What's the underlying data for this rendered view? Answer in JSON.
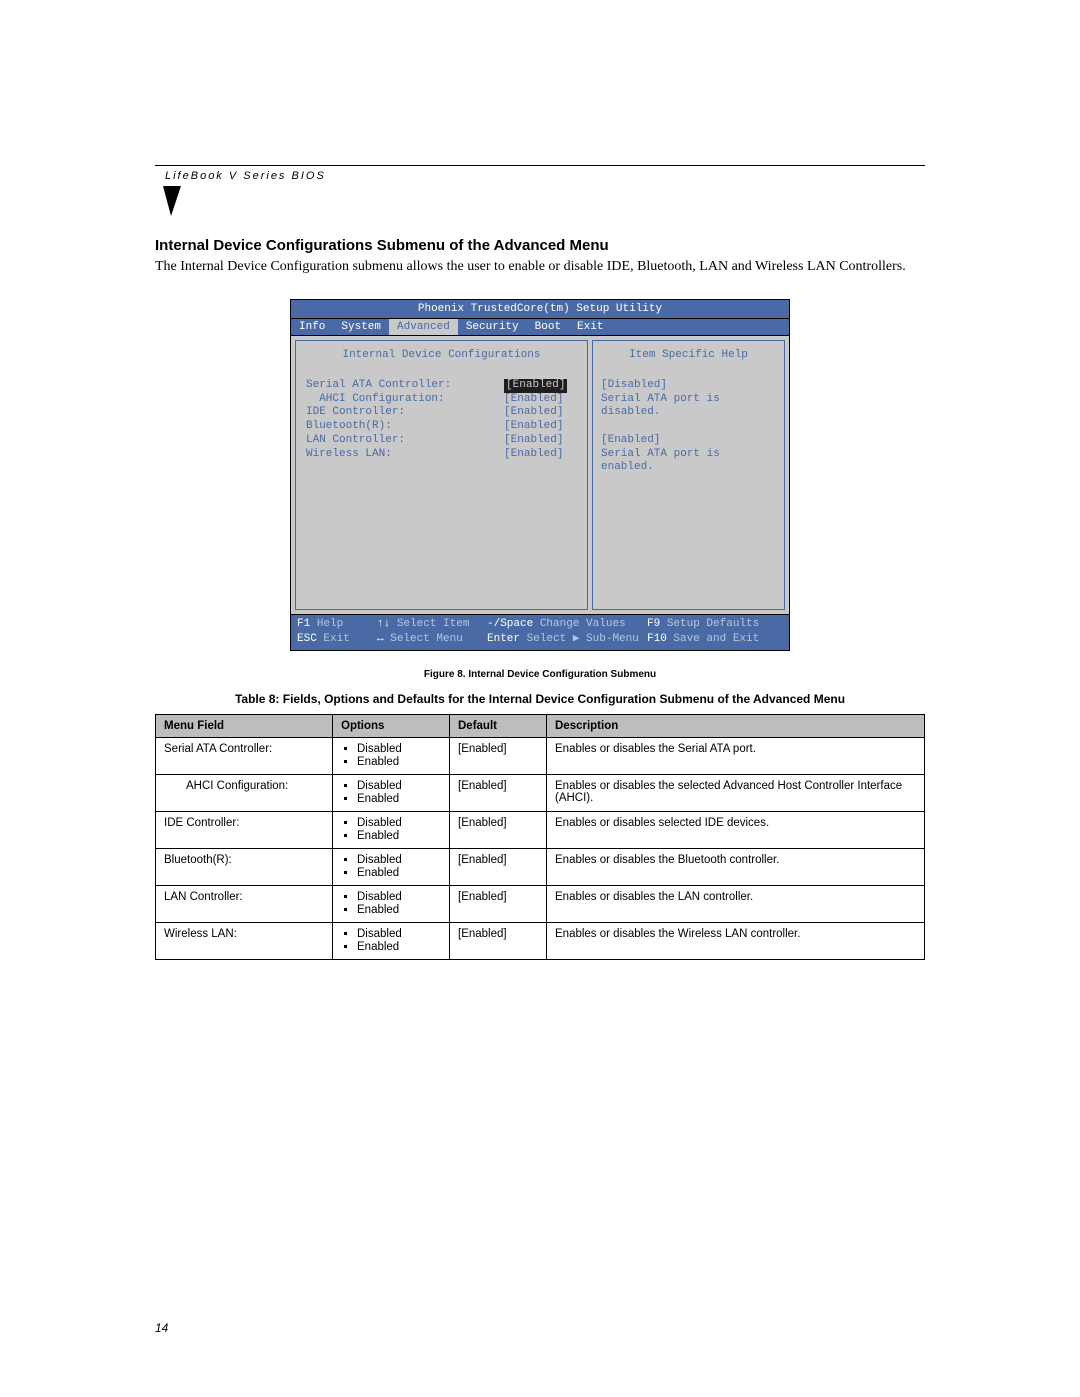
{
  "running_head": "LifeBook V Series BIOS",
  "section_title": "Internal Device Configurations Submenu of the Advanced Menu",
  "intro": "The Internal Device Configuration submenu allows the user to enable or disable IDE, Bluetooth, LAN and Wireless LAN Controllers.",
  "bios": {
    "utility_title": "Phoenix TrustedCore(tm) Setup Utility",
    "tabs": [
      "Info",
      "System",
      "Advanced",
      "Security",
      "Boot",
      "Exit"
    ],
    "active_tab": "Advanced",
    "left_title": "Internal Device Configurations",
    "right_title": "Item Specific Help",
    "items": [
      {
        "label": "Serial ATA Controller:",
        "value": "[Enabled]",
        "selected": true,
        "indent": 0
      },
      {
        "label": "AHCI Configuration:",
        "value": "[Enabled]",
        "selected": false,
        "indent": 1
      },
      {
        "label": "IDE Controller:",
        "value": "[Enabled]",
        "selected": false,
        "indent": 0
      },
      {
        "label": "Bluetooth(R):",
        "value": "[Enabled]",
        "selected": false,
        "indent": 0
      },
      {
        "label": "LAN Controller:",
        "value": "[Enabled]",
        "selected": false,
        "indent": 0
      },
      {
        "label": "Wireless LAN:",
        "value": "[Enabled]",
        "selected": false,
        "indent": 0
      }
    ],
    "help_lines": [
      "[Disabled]",
      "Serial ATA port is",
      "disabled.",
      "",
      "[Enabled]",
      "Serial ATA port is",
      "enabled."
    ],
    "footer": {
      "row1": [
        {
          "key": "F1",
          "lbl": "Help"
        },
        {
          "key": "↑↓",
          "lbl": "Select Item"
        },
        {
          "key": "-/Space",
          "lbl": "Change Values"
        },
        {
          "key": "F9",
          "lbl": "Setup Defaults"
        }
      ],
      "row2": [
        {
          "key": "ESC",
          "lbl": "Exit"
        },
        {
          "key": "↔",
          "lbl": "Select Menu"
        },
        {
          "key": "Enter",
          "lbl": "Select ▶ Sub-Menu"
        },
        {
          "key": "F10",
          "lbl": "Save and Exit"
        }
      ]
    }
  },
  "figure_caption": "Figure 8.  Internal Device Configuration Submenu",
  "table_title": "Table 8: Fields, Options and Defaults for the Internal Device Configuration Submenu of the Advanced Menu",
  "table": {
    "headers": [
      "Menu Field",
      "Options",
      "Default",
      "Description"
    ],
    "rows": [
      {
        "field": "Serial ATA Controller:",
        "indent": false,
        "options": [
          "Disabled",
          "Enabled"
        ],
        "default": "[Enabled]",
        "desc": "Enables or disables the Serial ATA port."
      },
      {
        "field": "AHCI Configuration:",
        "indent": true,
        "options": [
          "Disabled",
          "Enabled"
        ],
        "default": "[Enabled]",
        "desc": "Enables or disables the selected Advanced Host Controller Interface (AHCI)."
      },
      {
        "field": "IDE Controller:",
        "indent": false,
        "options": [
          "Disabled",
          "Enabled"
        ],
        "default": "[Enabled]",
        "desc": "Enables or disables selected IDE devices."
      },
      {
        "field": "Bluetooth(R):",
        "indent": false,
        "options": [
          "Disabled",
          "Enabled"
        ],
        "default": "[Enabled]",
        "desc": "Enables or disables the Bluetooth controller."
      },
      {
        "field": "LAN Controller:",
        "indent": false,
        "options": [
          "Disabled",
          "Enabled"
        ],
        "default": "[Enabled]",
        "desc": "Enables or disables the LAN controller."
      },
      {
        "field": "Wireless LAN:",
        "indent": false,
        "options": [
          "Disabled",
          "Enabled"
        ],
        "default": "[Enabled]",
        "desc": "Enables or disables the Wireless LAN controller."
      }
    ]
  },
  "page_number": "14"
}
